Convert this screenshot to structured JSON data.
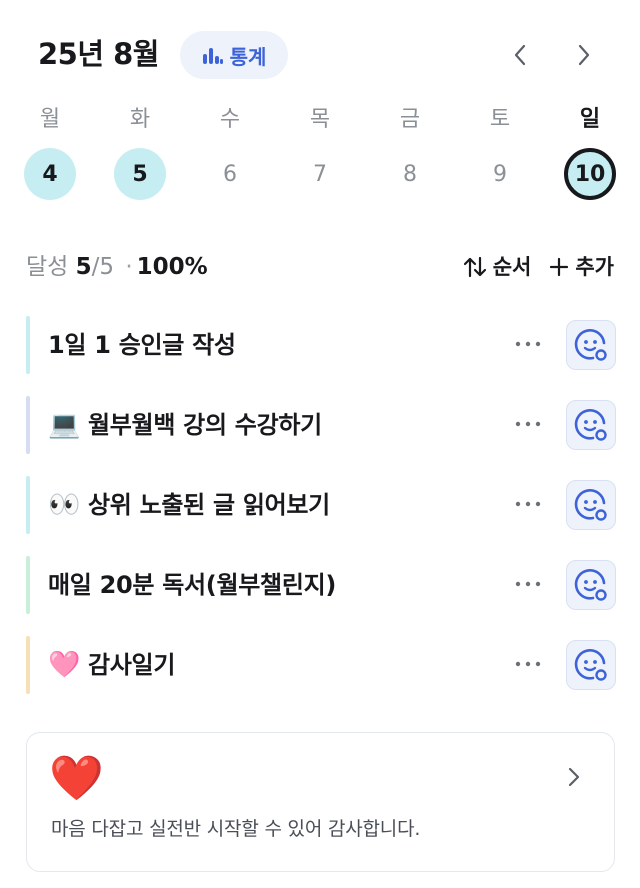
{
  "header": {
    "title": "25년 8월",
    "stats_label": "통계",
    "prev_icon": "chevron-left-icon",
    "next_icon": "chevron-right-icon",
    "accent": "#3d63d8"
  },
  "week": {
    "days": [
      "월",
      "화",
      "수",
      "목",
      "금",
      "토",
      "일"
    ],
    "dates": [
      "4",
      "5",
      "6",
      "7",
      "8",
      "9",
      "10"
    ],
    "done": [
      true,
      true,
      false,
      false,
      false,
      false,
      false
    ],
    "today_index": 6,
    "done_color": "#c6eef2"
  },
  "summary": {
    "label": "달성",
    "completed": "5",
    "total": "/5",
    "separator": "·",
    "percent": "100%",
    "sort_label": "순서",
    "add_label": "추가"
  },
  "tasks": [
    {
      "emoji": "",
      "title": "1일 1 승인글 작성",
      "bar_color": "#c6eef2"
    },
    {
      "emoji": "💻",
      "title": "월부월백 강의 수강하기",
      "bar_color": "#d6dcf2"
    },
    {
      "emoji": "👀",
      "title": "상위 노출된 글 읽어보기",
      "bar_color": "#c6eef2"
    },
    {
      "emoji": "",
      "title": "매일 20분 독서(월부챌린지)",
      "bar_color": "#c9efdb"
    },
    {
      "emoji": "🩷",
      "title": "감사일기",
      "bar_color": "#f7dfb7"
    }
  ],
  "gratitude": {
    "emoji": "❤️",
    "text": "마음 다잡고 실전반 시작할 수 있어 감사합니다."
  }
}
